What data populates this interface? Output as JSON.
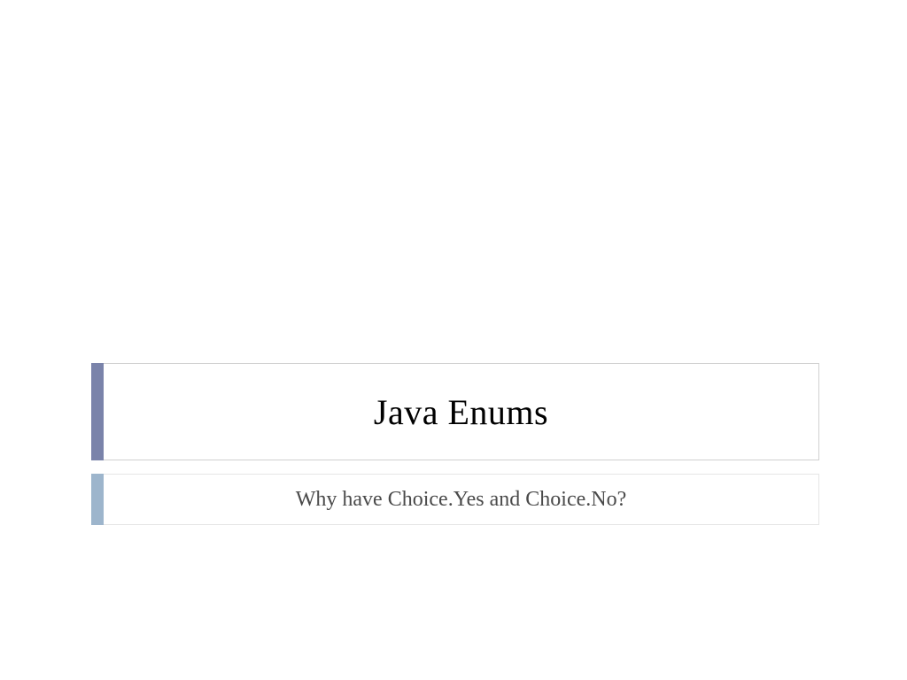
{
  "slide": {
    "title": "Java Enums",
    "subtitle": "Why have Choice.Yes and Choice.No?",
    "colors": {
      "title_accent": "#7a83aa",
      "subtitle_accent": "#9db5cc",
      "border": "#d0d0d0"
    }
  }
}
